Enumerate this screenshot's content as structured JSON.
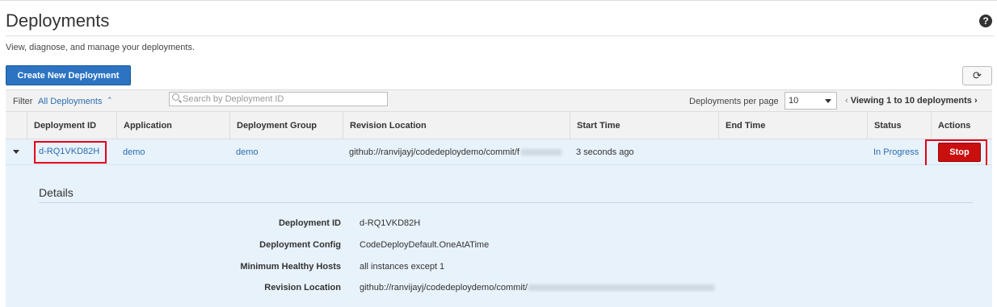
{
  "page": {
    "title": "Deployments",
    "subtitle": "View, diagnose, and manage your deployments.",
    "help_icon": "question-circle-icon"
  },
  "toolbar": {
    "create_label": "Create New Deployment",
    "refresh_icon": "refresh-icon"
  },
  "filter": {
    "label": "Filter",
    "value": "All Deployments",
    "chevron": "⌃",
    "search_placeholder": "Search by Deployment ID",
    "per_page_label": "Deployments per page",
    "per_page_value": "10",
    "pager_prev": "‹",
    "pager_text": "Viewing 1 to 10 deployments",
    "pager_next": "›"
  },
  "table": {
    "columns": [
      "Deployment ID",
      "Application",
      "Deployment Group",
      "Revision Location",
      "Start Time",
      "End Time",
      "Status",
      "Actions"
    ],
    "rows": [
      {
        "deployment_id": "d-RQ1VKD82H",
        "application": "demo",
        "deployment_group": "demo",
        "revision_location": "github://ranvijayj/codedeploydemo/commit/f",
        "start_time": "3 seconds ago",
        "end_time": "",
        "status": "In Progress",
        "action_label": "Stop"
      }
    ]
  },
  "details": {
    "title": "Details",
    "items": [
      {
        "label": "Deployment ID",
        "value": "d-RQ1VKD82H"
      },
      {
        "label": "Deployment Config",
        "value": "CodeDeployDefault.OneAtATime"
      },
      {
        "label": "Minimum Healthy Hosts",
        "value": "all instances except 1"
      },
      {
        "label": "Revision Location",
        "value": "github://ranvijayj/codedeploydemo/commit/"
      }
    ]
  },
  "colors": {
    "primary_button": "#2c74c2",
    "stop_button": "#c9100f",
    "highlight": "#e4001b",
    "link": "#2b6db3",
    "row_bg": "#e8f2fb"
  }
}
